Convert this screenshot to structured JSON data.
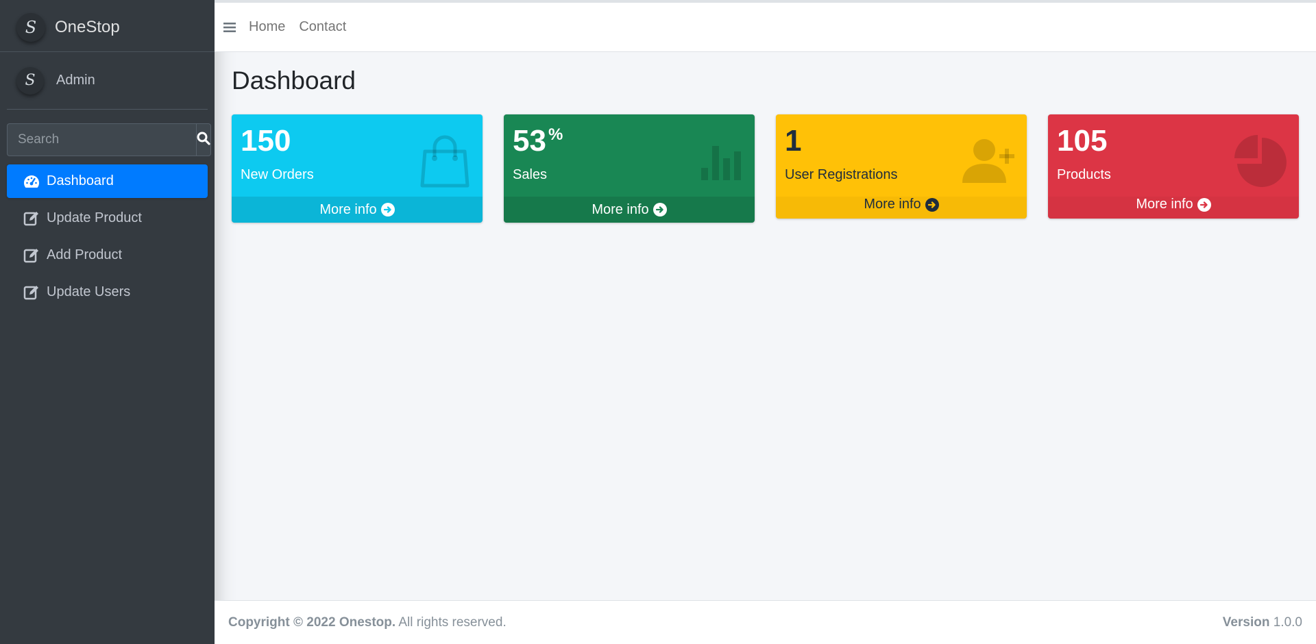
{
  "brand": {
    "name": "OneStop",
    "logo_glyph": "S"
  },
  "user": {
    "name": "Admin",
    "avatar_glyph": "S"
  },
  "search": {
    "placeholder": "Search"
  },
  "nav": {
    "items": [
      {
        "label": "Dashboard",
        "icon": "tachometer-icon",
        "active": true
      },
      {
        "label": "Update Product",
        "icon": "edit-icon"
      },
      {
        "label": "Add Product",
        "icon": "edit-icon"
      },
      {
        "label": "Update Users",
        "icon": "edit-icon"
      }
    ]
  },
  "topbar": {
    "links": [
      "Home",
      "Contact"
    ]
  },
  "page": {
    "title": "Dashboard"
  },
  "boxes": [
    {
      "value": "150",
      "suffix": "",
      "label": "New Orders",
      "footer": "More info",
      "icon": "shopping-bag-icon",
      "color": "#0dcaf0"
    },
    {
      "value": "53",
      "suffix": "%",
      "label": "Sales",
      "footer": "More info",
      "icon": "bar-chart-icon",
      "color": "#198754"
    },
    {
      "value": "1",
      "suffix": "",
      "label": "User Registrations",
      "footer": "More info",
      "icon": "user-plus-icon",
      "color": "#ffc107"
    },
    {
      "value": "105",
      "suffix": "",
      "label": "Products",
      "footer": "More info",
      "icon": "pie-chart-icon",
      "color": "#dc3545"
    }
  ],
  "footer": {
    "copyright": "Copyright © 2022 Onestop.",
    "rights": " All rights reserved.",
    "version_label": "Version",
    "version": " 1.0.0"
  }
}
